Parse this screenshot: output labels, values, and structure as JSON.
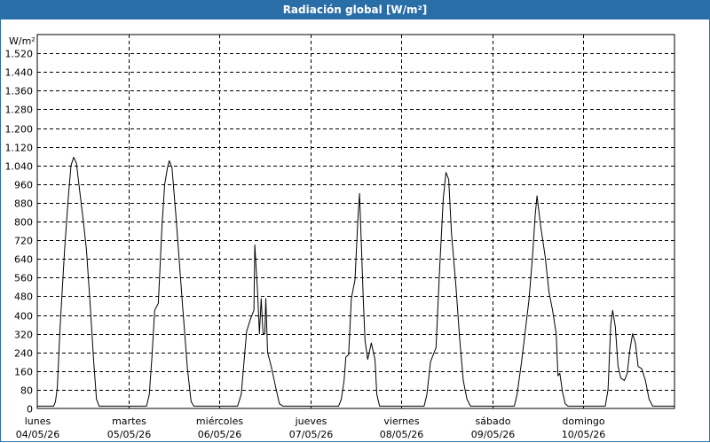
{
  "window": {
    "title": "Radiación global [W/m²]"
  },
  "chart_data": {
    "type": "line",
    "title": "Radiación global [W/m²]",
    "ylabel": "W/m²",
    "ylim": [
      0,
      1600
    ],
    "yticks": [
      0,
      80,
      160,
      240,
      320,
      400,
      480,
      560,
      640,
      720,
      800,
      880,
      960,
      1040,
      1120,
      1200,
      1280,
      1360,
      1440,
      1520
    ],
    "ytick_labels": [
      "0",
      "80",
      "160",
      "240",
      "320",
      "400",
      "480",
      "560",
      "640",
      "720",
      "800",
      "880",
      "960",
      "1.040",
      "1.120",
      "1.200",
      "1.280",
      "1.360",
      "1.440",
      "1.520"
    ],
    "xlim": [
      0,
      7
    ],
    "x_unit": "days from 04/05/26",
    "x_labels": [
      {
        "day": "lunes",
        "date": "04/05/26"
      },
      {
        "day": "martes",
        "date": "05/05/26"
      },
      {
        "day": "miércoles",
        "date": "06/05/26"
      },
      {
        "day": "jueves",
        "date": "07/05/26"
      },
      {
        "day": "viernes",
        "date": "08/05/26"
      },
      {
        "day": "sábado",
        "date": "09/05/26"
      },
      {
        "day": "domingo",
        "date": "10/05/26"
      }
    ],
    "grid": true,
    "series": [
      {
        "color": "#000000",
        "points": [
          [
            0.0,
            10
          ],
          [
            0.18,
            10
          ],
          [
            0.2,
            30
          ],
          [
            0.22,
            90
          ],
          [
            0.25,
            340
          ],
          [
            0.3,
            680
          ],
          [
            0.34,
            900
          ],
          [
            0.37,
            1040
          ],
          [
            0.4,
            1075
          ],
          [
            0.43,
            1050
          ],
          [
            0.46,
            950
          ],
          [
            0.5,
            820
          ],
          [
            0.54,
            680
          ],
          [
            0.58,
            450
          ],
          [
            0.62,
            200
          ],
          [
            0.65,
            40
          ],
          [
            0.68,
            10
          ],
          [
            1.0,
            10
          ],
          [
            1.2,
            10
          ],
          [
            1.23,
            60
          ],
          [
            1.26,
            220
          ],
          [
            1.29,
            420
          ],
          [
            1.33,
            450
          ],
          [
            1.37,
            780
          ],
          [
            1.4,
            960
          ],
          [
            1.43,
            1030
          ],
          [
            1.45,
            1060
          ],
          [
            1.48,
            1030
          ],
          [
            1.52,
            840
          ],
          [
            1.56,
            630
          ],
          [
            1.6,
            420
          ],
          [
            1.65,
            170
          ],
          [
            1.69,
            30
          ],
          [
            1.72,
            10
          ],
          [
            2.0,
            10
          ],
          [
            2.2,
            10
          ],
          [
            2.24,
            60
          ],
          [
            2.3,
            330
          ],
          [
            2.34,
            380
          ],
          [
            2.38,
            420
          ],
          [
            2.39,
            700
          ],
          [
            2.42,
            500
          ],
          [
            2.44,
            320
          ],
          [
            2.46,
            470
          ],
          [
            2.48,
            320
          ],
          [
            2.5,
            320
          ],
          [
            2.51,
            470
          ],
          [
            2.53,
            240
          ],
          [
            2.57,
            180
          ],
          [
            2.62,
            90
          ],
          [
            2.66,
            20
          ],
          [
            2.7,
            10
          ],
          [
            3.0,
            10
          ],
          [
            3.31,
            10
          ],
          [
            3.34,
            40
          ],
          [
            3.37,
            120
          ],
          [
            3.39,
            220
          ],
          [
            3.42,
            230
          ],
          [
            3.45,
            470
          ],
          [
            3.49,
            550
          ],
          [
            3.52,
            800
          ],
          [
            3.54,
            920
          ],
          [
            3.56,
            700
          ],
          [
            3.58,
            480
          ],
          [
            3.6,
            290
          ],
          [
            3.63,
            210
          ],
          [
            3.67,
            280
          ],
          [
            3.71,
            210
          ],
          [
            3.73,
            60
          ],
          [
            3.76,
            10
          ],
          [
            4.0,
            10
          ],
          [
            4.25,
            10
          ],
          [
            4.28,
            60
          ],
          [
            4.32,
            200
          ],
          [
            4.36,
            240
          ],
          [
            4.38,
            260
          ],
          [
            4.42,
            600
          ],
          [
            4.46,
            900
          ],
          [
            4.49,
            1010
          ],
          [
            4.52,
            980
          ],
          [
            4.55,
            750
          ],
          [
            4.6,
            520
          ],
          [
            4.64,
            300
          ],
          [
            4.68,
            120
          ],
          [
            4.72,
            40
          ],
          [
            4.76,
            10
          ],
          [
            5.0,
            10
          ],
          [
            5.24,
            10
          ],
          [
            5.27,
            60
          ],
          [
            5.32,
            200
          ],
          [
            5.36,
            330
          ],
          [
            5.4,
            460
          ],
          [
            5.44,
            650
          ],
          [
            5.47,
            830
          ],
          [
            5.49,
            910
          ],
          [
            5.53,
            780
          ],
          [
            5.58,
            650
          ],
          [
            5.62,
            500
          ],
          [
            5.66,
            420
          ],
          [
            5.7,
            320
          ],
          [
            5.72,
            140
          ],
          [
            5.74,
            150
          ],
          [
            5.77,
            70
          ],
          [
            5.8,
            20
          ],
          [
            5.83,
            10
          ],
          [
            6.0,
            10
          ],
          [
            6.24,
            10
          ],
          [
            6.27,
            80
          ],
          [
            6.3,
            360
          ],
          [
            6.32,
            420
          ],
          [
            6.35,
            350
          ],
          [
            6.38,
            180
          ],
          [
            6.41,
            130
          ],
          [
            6.45,
            120
          ],
          [
            6.48,
            150
          ],
          [
            6.51,
            250
          ],
          [
            6.54,
            320
          ],
          [
            6.57,
            280
          ],
          [
            6.6,
            180
          ],
          [
            6.64,
            170
          ],
          [
            6.68,
            120
          ],
          [
            6.72,
            40
          ],
          [
            6.76,
            10
          ],
          [
            7.0,
            10
          ]
        ]
      }
    ]
  }
}
